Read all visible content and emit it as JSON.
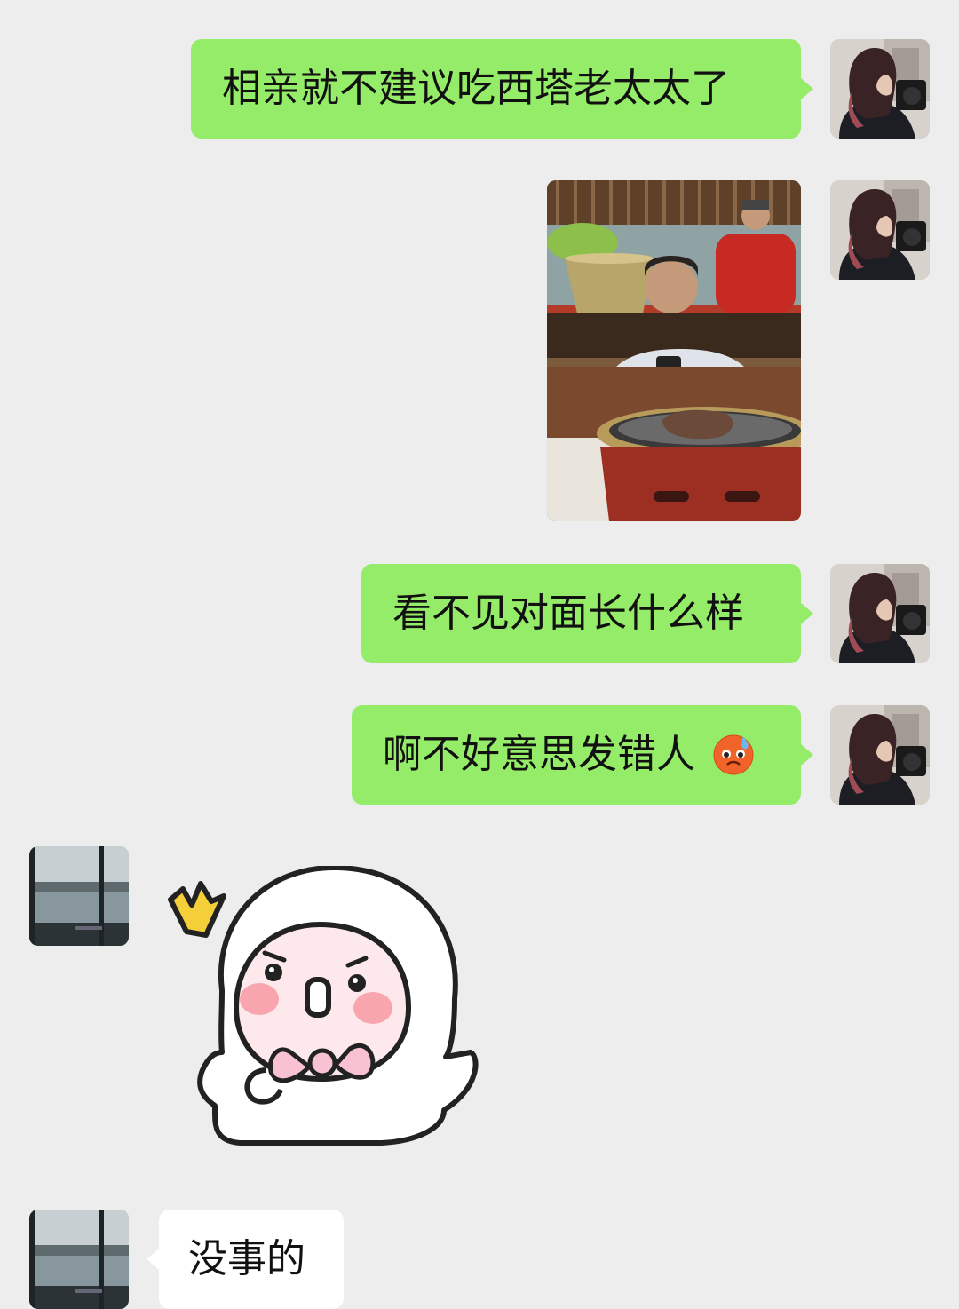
{
  "messages": [
    {
      "side": "me",
      "type": "text",
      "text": "相亲就不建议吃西塔老太太了"
    },
    {
      "side": "me",
      "type": "image",
      "description_icon": "photo"
    },
    {
      "side": "me",
      "type": "text",
      "text": "看不见对面长什么样"
    },
    {
      "side": "me",
      "type": "text",
      "text": "啊不好意思发错人",
      "emoji": "anxious-sweat-emoji"
    },
    {
      "side": "other",
      "type": "sticker",
      "sticker_icon": "surprised-doll-sticker"
    },
    {
      "side": "other",
      "type": "text",
      "text": "没事的"
    }
  ],
  "colors": {
    "background": "#ededed",
    "my_bubble": "#95ec69",
    "other_bubble": "#ffffff",
    "text": "#111111"
  }
}
